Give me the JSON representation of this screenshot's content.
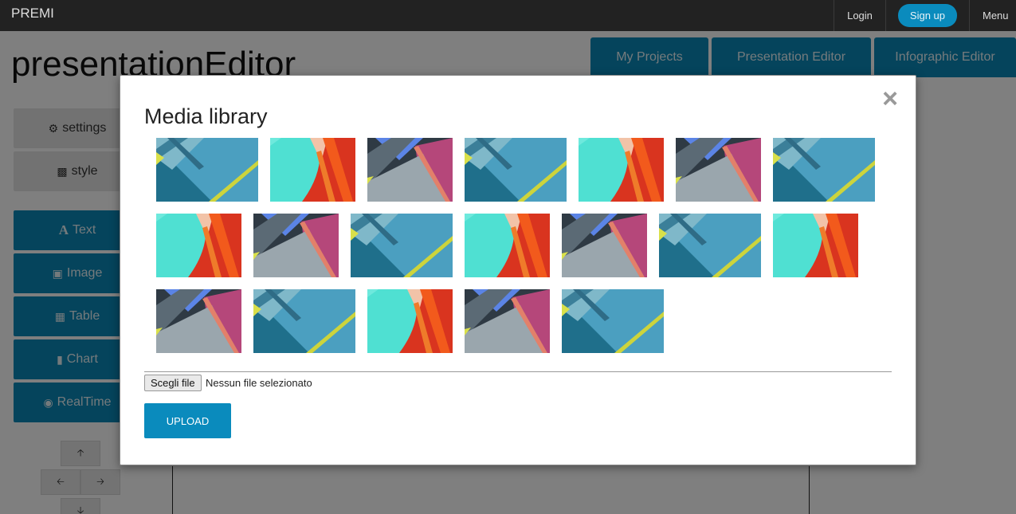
{
  "navbar": {
    "brand": "PREMI",
    "login": "Login",
    "signup": "Sign up",
    "menu": "Menu"
  },
  "page": {
    "title": "presentationEditor",
    "tabs": [
      "My Projects",
      "Presentation Editor",
      "Infographic Editor"
    ]
  },
  "sidebar": {
    "settings": "settings",
    "style": "style",
    "tools": [
      "Text",
      "Image",
      "Table",
      "Chart",
      "RealTime"
    ]
  },
  "modal": {
    "title": "Media library",
    "close_glyph": "×",
    "thumbnail_variants": [
      "blue-diagonal",
      "teal-red",
      "grey-pink",
      "blue-diagonal",
      "teal-red",
      "grey-pink",
      "blue-diagonal",
      "teal-red",
      "grey-pink",
      "blue-diagonal",
      "teal-red",
      "grey-pink",
      "blue-diagonal",
      "teal-red",
      "grey-pink",
      "blue-diagonal",
      "teal-red",
      "grey-pink",
      "blue-diagonal"
    ],
    "choose_file": "Scegli file",
    "no_file": "Nessun file selezionato",
    "upload": "UPLOAD"
  },
  "colors": {
    "accent": "#0b88b8",
    "navbar": "#222222",
    "overlay": "rgba(0,0,0,0.5)"
  }
}
